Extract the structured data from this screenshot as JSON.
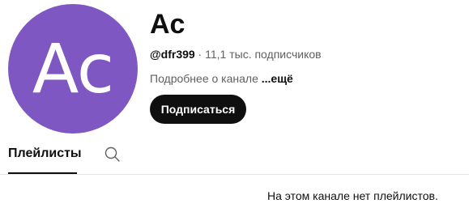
{
  "channel": {
    "avatar_initials": "Ac",
    "avatar_color": "#7e57c2",
    "name": "Ac",
    "handle": "@dfr399",
    "separator": " · ",
    "subscribers": "11,1 тыс. подписчиков",
    "about_text": "Подробнее о канале ",
    "about_more": "...ещё",
    "subscribe_label": "Подписаться"
  },
  "tabs": {
    "playlists_label": "Плейлисты",
    "search_icon": "search-icon"
  },
  "content": {
    "empty_message": "На этом канале нет плейлистов."
  }
}
